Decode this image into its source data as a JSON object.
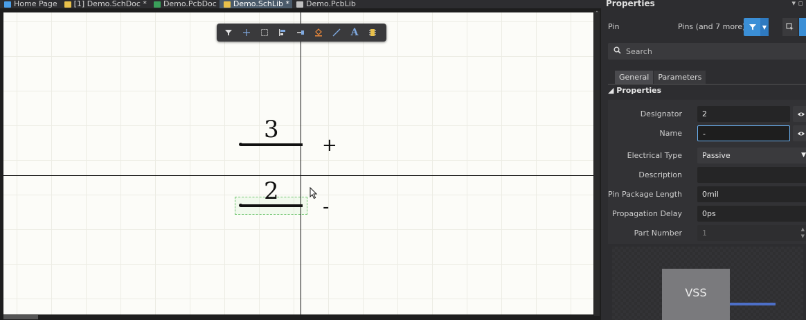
{
  "tabs": [
    {
      "label": "Home Page",
      "icon": "home-icon",
      "color": "#4a9ee8",
      "active": false
    },
    {
      "label": "[1] Demo.SchDoc *",
      "icon": "schdoc-icon",
      "color": "#e8c04a",
      "active": false
    },
    {
      "label": "Demo.PcbDoc",
      "icon": "pcbdoc-icon",
      "color": "#3aa05a",
      "active": false
    },
    {
      "label": "Demo.SchLib *",
      "icon": "schlib-icon",
      "color": "#e8c04a",
      "active": true
    },
    {
      "label": "Demo.PcbLib",
      "icon": "pcblib-icon",
      "color": "#c0c0c0",
      "active": false
    }
  ],
  "toolbar": {
    "tools": [
      "filter-icon",
      "add-icon",
      "rect-select-icon",
      "align-icon",
      "place-pin-icon",
      "fill-icon",
      "line-icon",
      "text-icon",
      "component-icon"
    ]
  },
  "canvas": {
    "pins": [
      {
        "number": "3",
        "symbol": "+"
      },
      {
        "number": "2",
        "symbol": "-"
      }
    ]
  },
  "panel": {
    "title": "Properties",
    "object_kind": "Pin",
    "object_filter": "Pins (and 7 more)",
    "search_placeholder": "Search",
    "tabs": [
      "General",
      "Parameters"
    ],
    "section": "Properties",
    "fields": {
      "designator_label": "Designator",
      "designator_value": "2",
      "name_label": "Name",
      "name_value": "-",
      "electrical_type_label": "Electrical Type",
      "electrical_type_value": "Passive",
      "description_label": "Description",
      "description_value": "",
      "pin_package_length_label": "Pin Package Length",
      "pin_package_length_value": "0mil",
      "propagation_delay_label": "Propagation Delay",
      "propagation_delay_value": "0ps",
      "part_number_label": "Part Number",
      "part_number_value": "1"
    },
    "preview_label": "VSS",
    "accent": "#3b8fd6"
  }
}
